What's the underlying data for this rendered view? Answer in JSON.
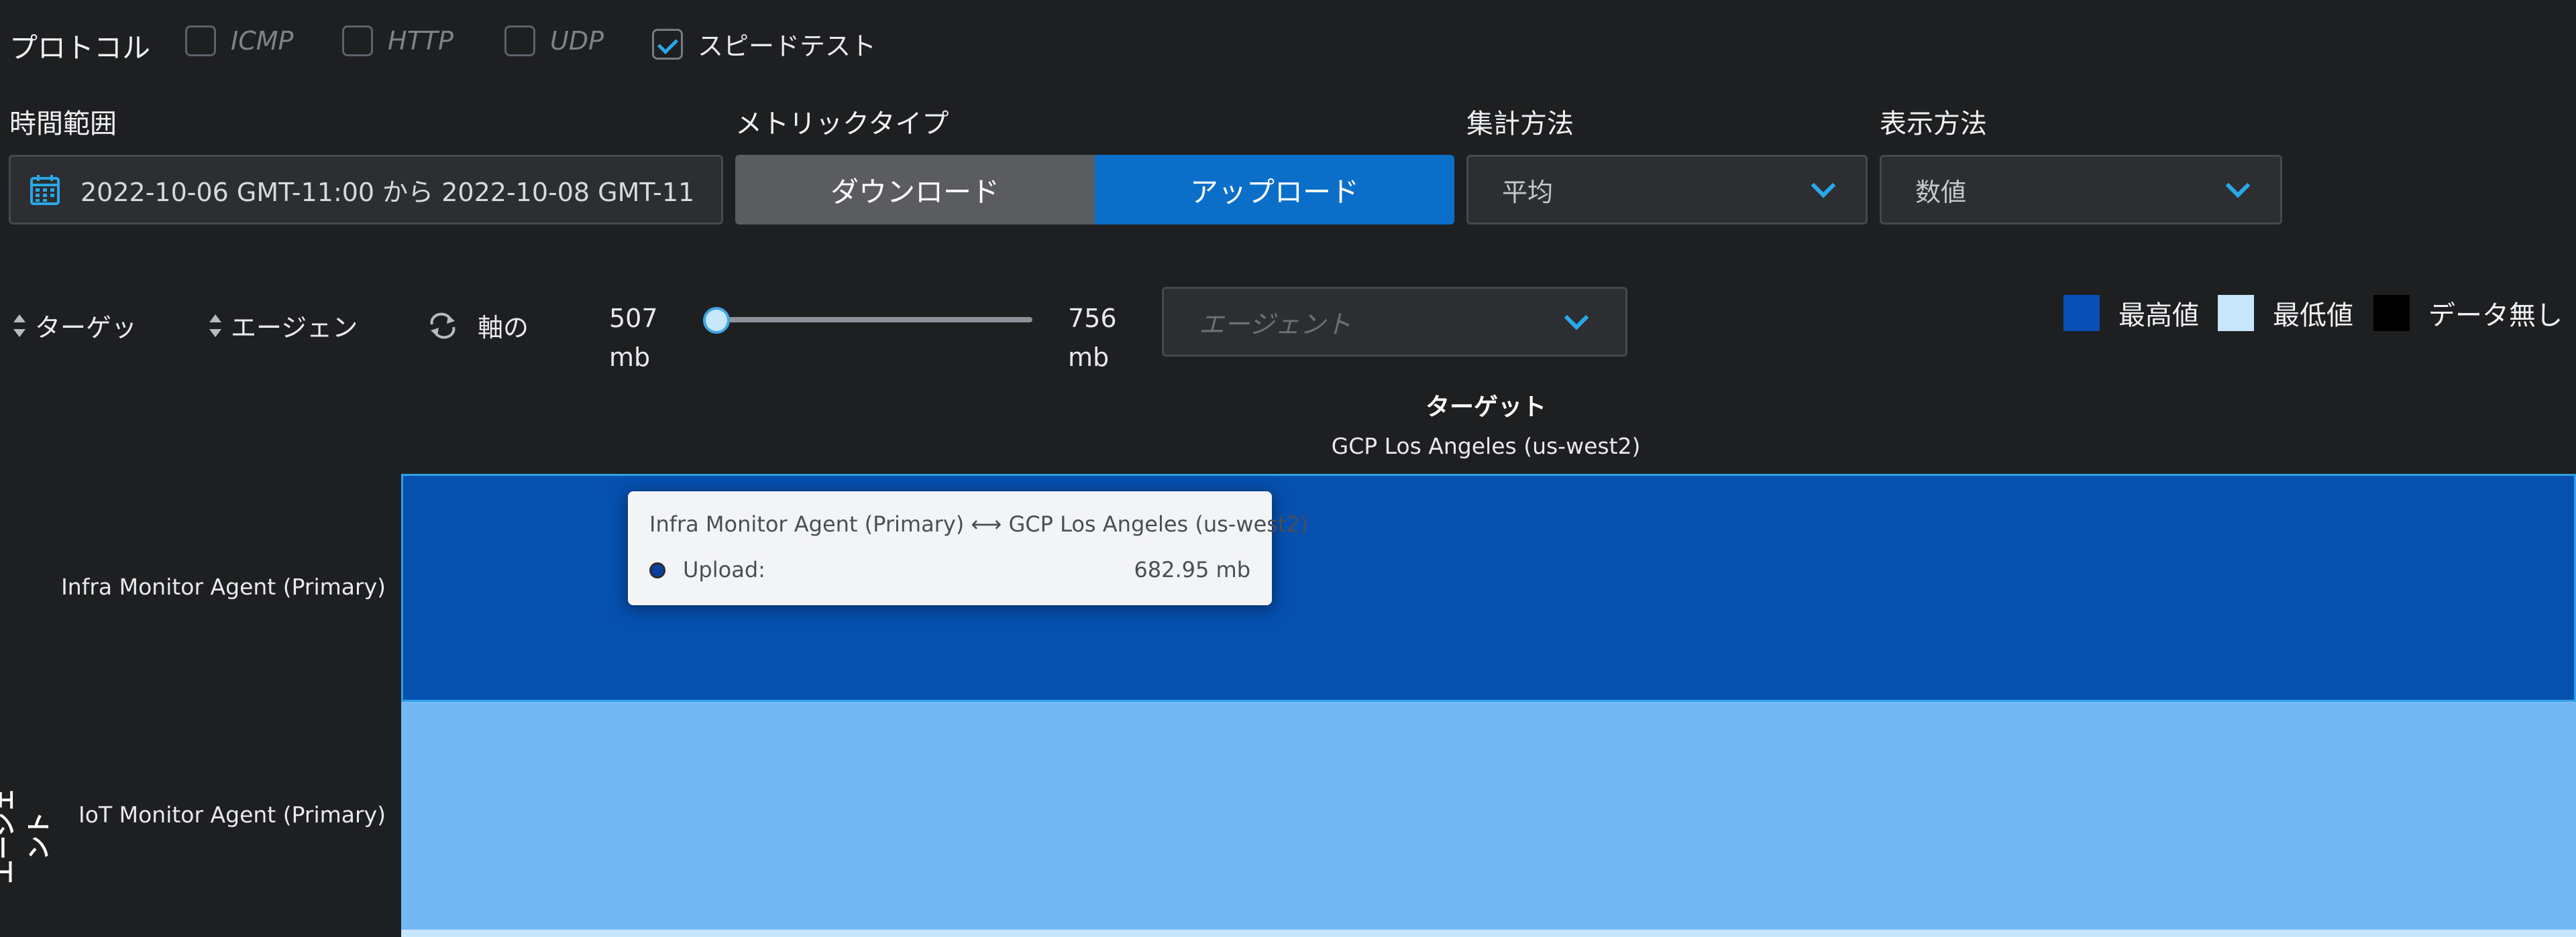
{
  "protocol": {
    "label": "プロトコル",
    "options": [
      {
        "label": "ICMP",
        "checked": false
      },
      {
        "label": "HTTP",
        "checked": false
      },
      {
        "label": "UDP",
        "checked": false
      },
      {
        "label": "スピードテスト",
        "checked": true
      }
    ]
  },
  "time_range": {
    "label": "時間範囲",
    "value": "2022-10-06 GMT-11:00 から 2022-10-08 GMT-11",
    "icon": "calendar-icon"
  },
  "metric_type": {
    "label": "メトリックタイプ",
    "options": [
      "ダウンロード",
      "アップロード"
    ],
    "selected": "アップロード"
  },
  "aggregation": {
    "label": "集計方法",
    "value": "平均"
  },
  "display": {
    "label": "表示方法",
    "value": "数値"
  },
  "controls": {
    "sort_target": "ターゲッ",
    "sort_agent": "エージェン",
    "swap_axis": "軸の",
    "swap_icon": "swap-arrows-icon",
    "range_min_value": "507",
    "range_min_unit": "mb",
    "range_max_value": "756",
    "range_max_unit": "mb",
    "slider_level": 0.0,
    "agent_placeholder": "エージェント"
  },
  "legend": {
    "items": [
      {
        "label": "最高値",
        "color": "#0a4fb5"
      },
      {
        "label": "最低値",
        "color": "#c6e6fb"
      },
      {
        "label": "データ無し",
        "color": "#000000"
      }
    ]
  },
  "heatmap": {
    "target_axis_title": "ターゲット",
    "target_name": "GCP Los Angeles (us-west2)",
    "agent_axis_title": "エージェント",
    "rows": [
      {
        "agent": "Infra Monitor Agent (Primary)",
        "color": "#0650b0"
      },
      {
        "agent": "IoT Monitor Agent (Primary)",
        "color": "#74b8f3"
      }
    ]
  },
  "tooltip": {
    "title": "Infra Monitor Agent (Primary) ⟷ GCP Los Angeles (us-west2)",
    "metric": "Upload:",
    "value": "682.95 mb"
  }
}
